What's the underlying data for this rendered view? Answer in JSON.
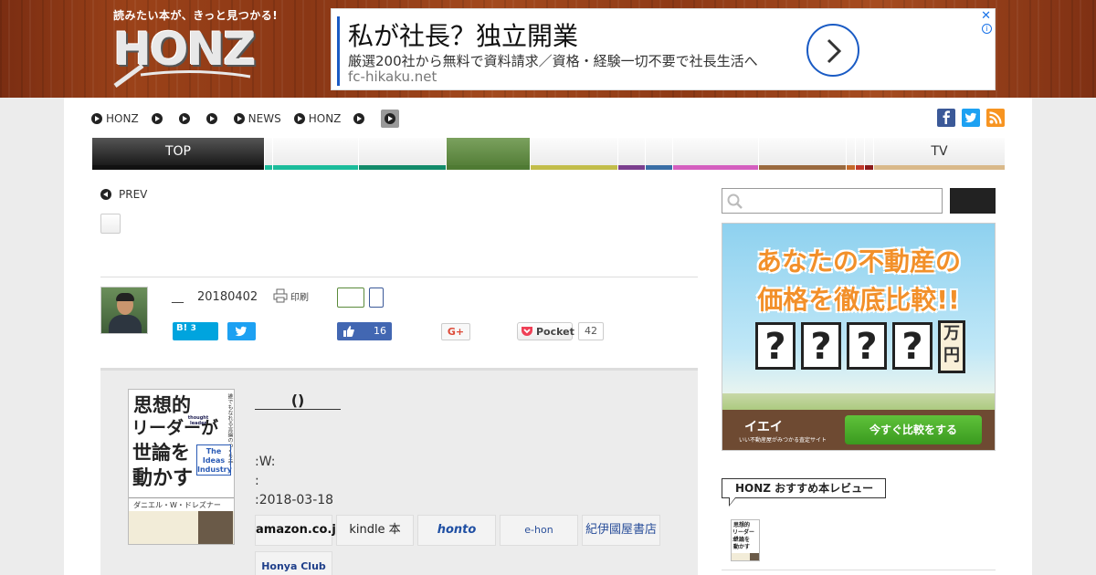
{
  "header": {
    "tagline": "読みたい本が、きっと見つかる!",
    "logo_text": "HONZ"
  },
  "ad": {
    "title": "私が社長？独立開業",
    "subtitle": "厳選200社から無料で資料請求／資格・経験一切不要で社長生活へ",
    "url": "fc-hikaku.net",
    "close_glyph": "✕",
    "info_glyph": "i"
  },
  "topnav": {
    "items": [
      "HONZ",
      "",
      "",
      "",
      "NEWS",
      "HONZ",
      ""
    ]
  },
  "categories": {
    "top_label": "TOP",
    "tv_label": "TV",
    "colors": [
      "#1bbc9b",
      "#128b6a",
      "#4f7a33",
      "#c2bd4a",
      "#7b3f8e",
      "#3a6ea5",
      "#d45fbf",
      "#9a6a3f",
      "#c46a2a",
      "#c0392b",
      "#8b1a1a",
      "#d9b98a"
    ]
  },
  "article": {
    "prev_label": "PREV",
    "author": "__",
    "date": "20180402",
    "print_label": "印刷",
    "hatena_label": "B!",
    "hatena_count": "3",
    "like_count": "16",
    "gplus_label": "G+",
    "pocket_label": "Pocket",
    "pocket_count": "42"
  },
  "book": {
    "title": "()",
    "author_line": ":W:",
    "publisher_line": ":",
    "date_line": ":2018-03-18",
    "cover_title_l1": "思想的",
    "cover_title_l2": "リーダーが",
    "cover_title_l3": "世論を",
    "cover_title_l4": "動かす",
    "cover_thought": "thought leader",
    "cover_side": "誰でもなれる言論のつくり手",
    "cover_en": "The Ideas Industry",
    "cover_author": "ダニエル・W・ドレズナー",
    "buy_buttons": [
      "amazon.co.jp",
      "kindle 本",
      "honto",
      "e-hon",
      "紀伊國屋書店",
      "Honya Club"
    ]
  },
  "sidebar": {
    "search_placeholder": "",
    "banner": {
      "line1": "あなたの不動産の",
      "line2": "価格を徹底比較!!",
      "q": "?",
      "unit": "万円",
      "brand": "イエイ",
      "brand_sub": "いい不動産屋がみつかる査定サイト",
      "cta": "今すぐ比較をする"
    },
    "recommend_title": "HONZ おすすめ本レビュー"
  }
}
